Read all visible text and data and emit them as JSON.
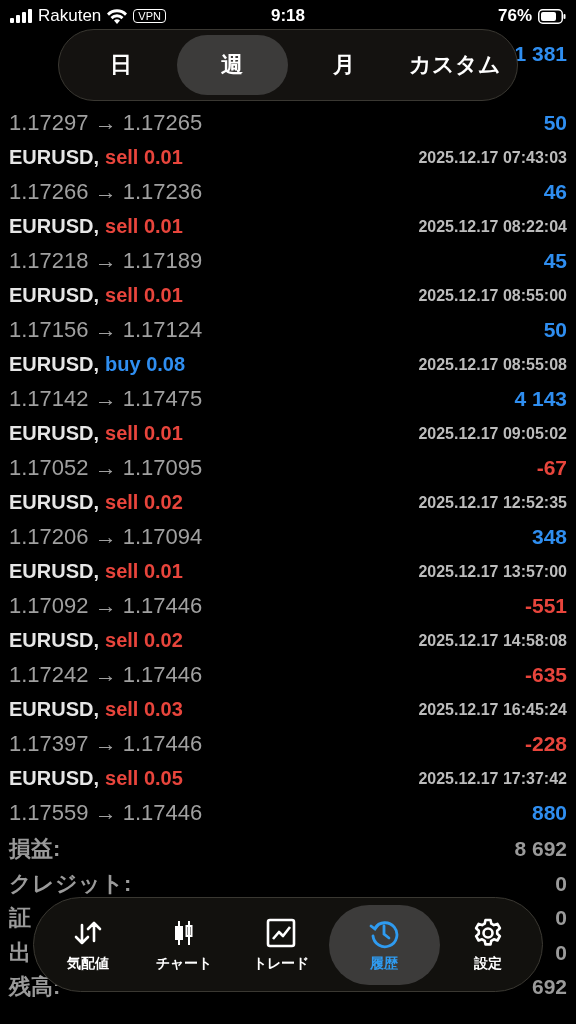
{
  "status_bar": {
    "carrier": "Rakuten",
    "vpn": "VPN",
    "time": "9:18",
    "battery": "76%"
  },
  "period_tabs": [
    {
      "label": "日",
      "selected": false
    },
    {
      "label": "週",
      "selected": true
    },
    {
      "label": "月",
      "selected": false
    },
    {
      "label": "カスタム",
      "selected": false
    }
  ],
  "deals": [
    {
      "profit": "1 381",
      "color": "#2f8ef0"
    },
    {
      "prices": "1.17297 → 1.17265",
      "profit": "50",
      "color": "#2f8ef0"
    },
    {
      "symbol": "EURUSD,",
      "kind": "sell",
      "trade": "sell 0.01",
      "time": "2025.12.17 07:43:03",
      "prices": "1.17266 → 1.17236",
      "profit": "46",
      "color": "#2f8ef0"
    },
    {
      "symbol": "EURUSD,",
      "kind": "sell",
      "trade": "sell 0.01",
      "time": "2025.12.17 08:22:04",
      "prices": "1.17218 → 1.17189",
      "profit": "45",
      "color": "#2f8ef0"
    },
    {
      "symbol": "EURUSD,",
      "kind": "sell",
      "trade": "sell 0.01",
      "time": "2025.12.17 08:55:00",
      "prices": "1.17156 → 1.17124",
      "profit": "50",
      "color": "#2f8ef0"
    },
    {
      "symbol": "EURUSD,",
      "kind": "buy",
      "trade": "buy 0.08",
      "time": "2025.12.17 08:55:08",
      "prices": "1.17142 → 1.17475",
      "profit": "4 143",
      "color": "#2f8ef0"
    },
    {
      "symbol": "EURUSD,",
      "kind": "sell",
      "trade": "sell 0.01",
      "time": "2025.12.17 09:05:02",
      "prices": "1.17052 → 1.17095",
      "profit": "-67",
      "color": "#e8453c"
    },
    {
      "symbol": "EURUSD,",
      "kind": "sell",
      "trade": "sell 0.02",
      "time": "2025.12.17 12:52:35",
      "prices": "1.17206 → 1.17094",
      "profit": "348",
      "color": "#2f8ef0"
    },
    {
      "symbol": "EURUSD,",
      "kind": "sell",
      "trade": "sell 0.01",
      "time": "2025.12.17 13:57:00",
      "prices": "1.17092 → 1.17446",
      "profit": "-551",
      "color": "#e8453c"
    },
    {
      "symbol": "EURUSD,",
      "kind": "sell",
      "trade": "sell 0.02",
      "time": "2025.12.17 14:58:08",
      "prices": "1.17242 → 1.17446",
      "profit": "-635",
      "color": "#e8453c"
    },
    {
      "symbol": "EURUSD,",
      "kind": "sell",
      "trade": "sell 0.03",
      "time": "2025.12.17 16:45:24",
      "prices": "1.17397 → 1.17446",
      "profit": "-228",
      "color": "#e8453c"
    },
    {
      "symbol": "EURUSD,",
      "kind": "sell",
      "trade": "sell 0.05",
      "time": "2025.12.17 17:37:42",
      "prices": "1.17559 → 1.17446",
      "profit": "880",
      "color": "#2f8ef0"
    }
  ],
  "summary": [
    {
      "label": "損益:",
      "value": "8 692"
    },
    {
      "label": "クレジット:",
      "value": "0"
    },
    {
      "label": "証",
      "value": "0"
    },
    {
      "label": "出",
      "value": "0"
    },
    {
      "label": "残高:",
      "value": "692"
    }
  ],
  "nav_tabs": [
    {
      "label": "気配値",
      "kind": "quotes",
      "selected": false
    },
    {
      "label": "チャート",
      "kind": "chart",
      "selected": false
    },
    {
      "label": "トレード",
      "kind": "trade",
      "selected": false
    },
    {
      "label": "履歴",
      "kind": "history",
      "selected": true
    },
    {
      "label": "設定",
      "kind": "settings",
      "selected": false
    }
  ]
}
